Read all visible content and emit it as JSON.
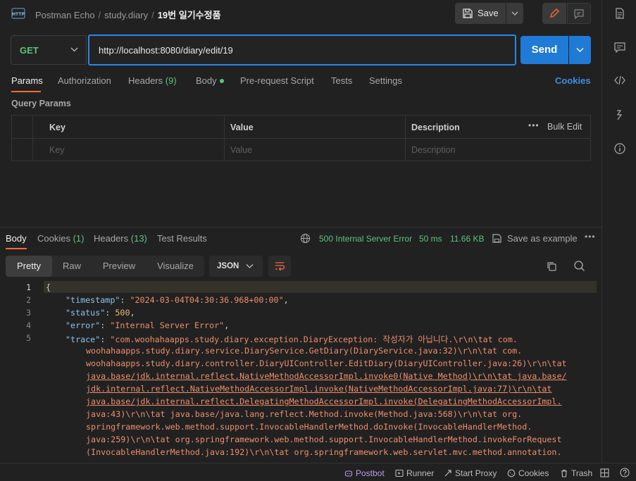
{
  "header": {
    "app_icon_label": "HTTP",
    "breadcrumb": [
      "Postman Echo",
      "study.diary"
    ],
    "current_request": "19번 일기수정품",
    "save_label": "Save"
  },
  "request": {
    "method": "GET",
    "url": "http://localhost:8080/diary/edit/19",
    "send_label": "Send"
  },
  "request_tabs": {
    "params": "Params",
    "authorization": "Authorization",
    "headers": "Headers",
    "headers_count": "(9)",
    "body": "Body",
    "pre_request": "Pre-request Script",
    "tests": "Tests",
    "settings": "Settings",
    "cookies": "Cookies"
  },
  "query_params": {
    "title": "Query Params",
    "columns": [
      "Key",
      "Value",
      "Description"
    ],
    "bulk_edit": "Bulk Edit",
    "placeholders": [
      "Key",
      "Value",
      "Description"
    ]
  },
  "response": {
    "tabs": {
      "body": "Body",
      "cookies": "Cookies",
      "cookies_count": "(1)",
      "headers": "Headers",
      "headers_count": "(13)",
      "test_results": "Test Results"
    },
    "status": "500 Internal Server Error",
    "time": "50 ms",
    "size": "11.66 KB",
    "save_example": "Save as example",
    "view_tabs": [
      "Pretty",
      "Raw",
      "Preview",
      "Visualize"
    ],
    "format": "JSON",
    "line_numbers": [
      "1",
      "2",
      "3",
      "4",
      "5"
    ],
    "json": {
      "timestamp_key": "\"timestamp\"",
      "timestamp_value": "\"2024-03-04T04:30:36.968+00:00\"",
      "status_key": "\"status\"",
      "status_value": "500",
      "error_key": "\"error\"",
      "error_value": "\"Internal Server Error\"",
      "trace_key": "\"trace\"",
      "trace_lines": [
        "\"com.woohahaapps.study.diary.exception.DiaryException: 작성자가 아닙니다.\\r\\n\\tat com.",
        "woohahaapps.study.diary.service.DiaryService.GetDiary(DiaryService.java:32)\\r\\n\\tat com.",
        "woohahaapps.study.diary.controller.DiaryUIController.EditDiary(DiaryUIController.java:26)\\r\\n\\tat",
        "java.base/jdk.internal.reflect.NativeMethodAccessorImpl.invoke0(Native Method)\\r\\n\\tat java.base/",
        "jdk.internal.reflect.NativeMethodAccessorImpl.invoke(NativeMethodAccessorImpl.java:77)\\r\\n\\tat",
        "java.base/jdk.internal.reflect.DelegatingMethodAccessorImpl.invoke(DelegatingMethodAccessorImpl.",
        "java:43)\\r\\n\\tat java.base/java.lang.reflect.Method.invoke(Method.java:568)\\r\\n\\tat org.",
        "springframework.web.method.support.InvocableHandlerMethod.doInvoke(InvocableHandlerMethod.",
        "java:259)\\r\\n\\tat org.springframework.web.method.support.InvocableHandlerMethod.invokeForRequest",
        "(InvocableHandlerMethod.java:192)\\r\\n\\tat org.springframework.web.servlet.mvc.method.annotation."
      ]
    }
  },
  "statusbar": {
    "postbot": "Postbot",
    "runner": "Runner",
    "start_proxy": "Start Proxy",
    "cookies": "Cookies",
    "trash": "Trash"
  },
  "colors": {
    "accent_orange": "#f26b3a",
    "send_blue": "#1f7bd6",
    "status_green": "#5ec27c",
    "json_key": "#8fc1ec",
    "json_string": "#ee8e6c"
  }
}
